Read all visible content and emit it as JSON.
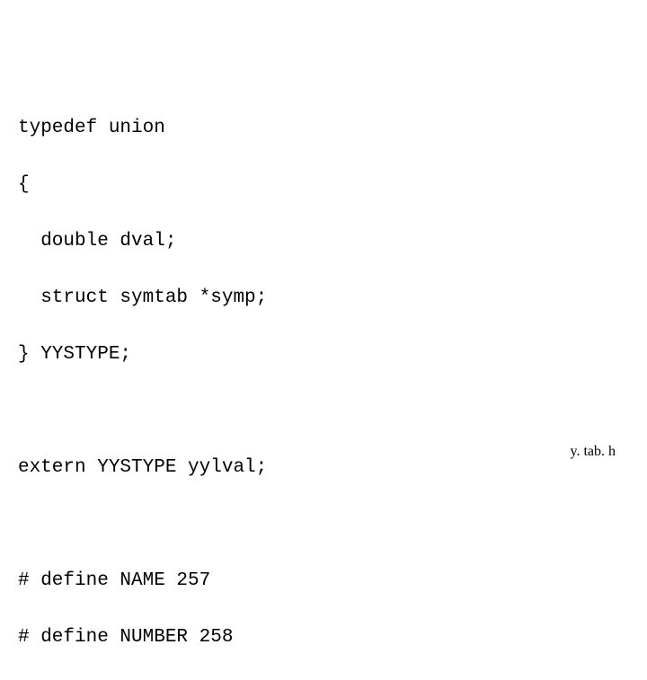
{
  "code": {
    "line1": "typedef union",
    "line2": "{",
    "line3": "  double dval;",
    "line4": "  struct symtab *symp;",
    "line5": "} YYSTYPE;",
    "line6": "",
    "line7": "extern YYSTYPE yylval;",
    "line8": "",
    "line9": "# define NAME 257",
    "line10": "# define NUMBER 258"
  },
  "footer": "y. tab. h"
}
